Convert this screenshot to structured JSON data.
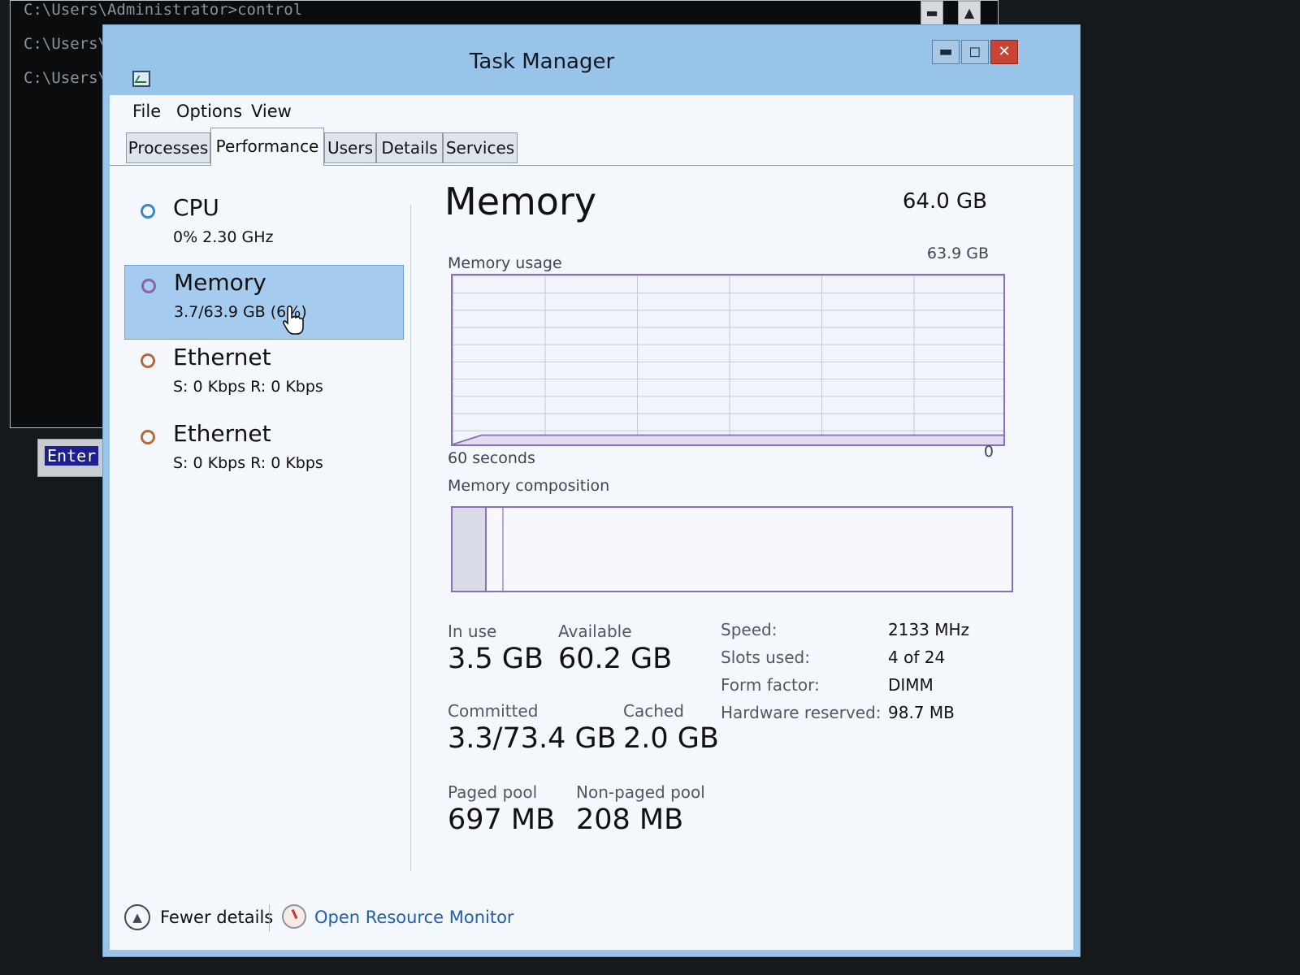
{
  "console": {
    "lines": [
      "C:\\Users\\Administrator>control",
      "C:\\Users\\Administrator>taskmgr",
      "C:\\Users\\"
    ],
    "enter_label": "Enter"
  },
  "window": {
    "title": "Task Manager",
    "controls": {
      "minimize": "▬",
      "maximize": "◻",
      "close": "✕"
    }
  },
  "menu": [
    "File",
    "Options",
    "View"
  ],
  "tabs": [
    {
      "label": "Processes",
      "active": false
    },
    {
      "label": "Performance",
      "active": true
    },
    {
      "label": "Users",
      "active": false
    },
    {
      "label": "Details",
      "active": false
    },
    {
      "label": "Services",
      "active": false
    }
  ],
  "sidebar": [
    {
      "title": "CPU",
      "subtitle": "0% 2.30 GHz",
      "icon": "cpu-circle-icon",
      "selected": false
    },
    {
      "title": "Memory",
      "subtitle": "3.7/63.9 GB (6%)",
      "icon": "memory-circle-icon",
      "selected": true
    },
    {
      "title": "Ethernet",
      "subtitle": "S: 0 Kbps R: 0 Kbps",
      "icon": "ethernet-circle-icon",
      "selected": false
    },
    {
      "title": "Ethernet",
      "subtitle": "S: 0 Kbps R: 0 Kbps",
      "icon": "ethernet-circle-icon",
      "selected": false
    }
  ],
  "memory": {
    "title": "Memory",
    "total": "64.0 GB",
    "usage_label": "Memory usage",
    "usage_max": "63.9 GB",
    "time_label": "60 seconds",
    "min_label": "0",
    "composition_label": "Memory composition",
    "in_use_fraction": 0.058,
    "standby_fraction": 0.03,
    "usage_fraction": 0.055,
    "stats": {
      "in_use": {
        "label": "In use",
        "value": "3.5 GB"
      },
      "available": {
        "label": "Available",
        "value": "60.2 GB"
      },
      "committed": {
        "label": "Committed",
        "value": "3.3/73.4 GB"
      },
      "cached": {
        "label": "Cached",
        "value": "2.0 GB"
      },
      "paged_pool": {
        "label": "Paged pool",
        "value": "697 MB"
      },
      "non_paged_pool": {
        "label": "Non-paged pool",
        "value": "208 MB"
      }
    },
    "specs": [
      {
        "label": "Speed:",
        "value": "2133 MHz"
      },
      {
        "label": "Slots used:",
        "value": "4 of 24"
      },
      {
        "label": "Form factor:",
        "value": "DIMM"
      },
      {
        "label": "Hardware reserved:",
        "value": "98.7 MB"
      }
    ]
  },
  "footer": {
    "fewer_details": "Fewer details",
    "resource_monitor": "Open Resource Monitor"
  },
  "colors": {
    "memory_accent": "#8b6fb6",
    "selected_item": "#a5cbef",
    "link": "#1f5fae"
  }
}
